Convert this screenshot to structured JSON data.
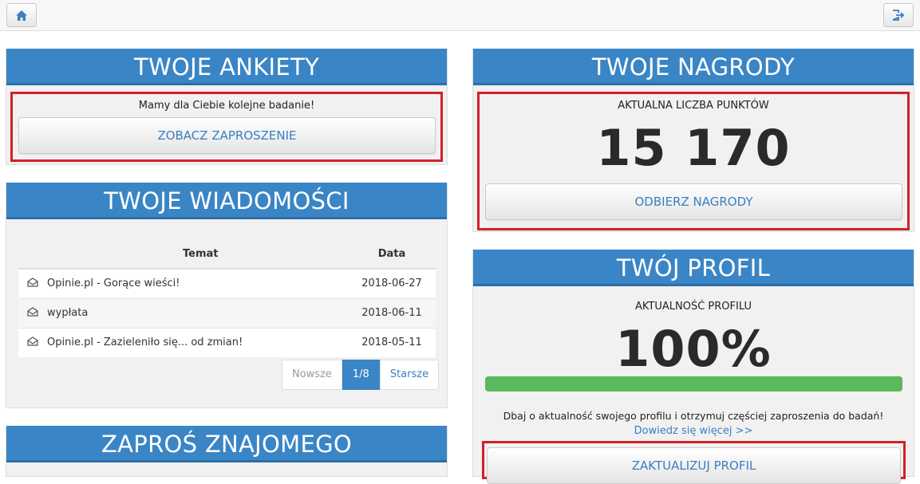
{
  "colors": {
    "header": "#3a85c6",
    "highlight": "#d32027",
    "link": "#3a7fc1",
    "progress": "#5cb85c"
  },
  "topbar": {
    "home_icon": "home-icon",
    "logout_icon": "logout-icon"
  },
  "surveys": {
    "title": "TWOJE ANKIETY",
    "message": "Mamy dla Ciebie kolejne badanie!",
    "button": "ZOBACZ ZAPROSZENIE"
  },
  "messages": {
    "title": "TWOJE WIADOMOŚCI",
    "headers": {
      "subject": "Temat",
      "date": "Data"
    },
    "rows": [
      {
        "subject": "Opinie.pl - Gorące wieści!",
        "date": "2018-06-27"
      },
      {
        "subject": "wypłata",
        "date": "2018-06-11"
      },
      {
        "subject": "Opinie.pl - Zazieleniło się... od zmian!",
        "date": "2018-05-11"
      }
    ],
    "pager": {
      "prev": "Nowsze",
      "current": "1/8",
      "next": "Starsze"
    }
  },
  "invite": {
    "title": "ZAPROŚ ZNAJOMEGO"
  },
  "rewards": {
    "title": "TWOJE NAGRODY",
    "caption": "AKTUALNA LICZBA PUNKTÓW",
    "points": "15 170",
    "button": "ODBIERZ NAGRODY"
  },
  "profile": {
    "title": "TWÓJ PROFIL",
    "caption": "AKTUALNOŚĆ PROFILU",
    "percent_text": "100%",
    "progress_fraction": 1.0,
    "hint": "Dbaj o aktualność swojego profilu i otrzymuj częściej zaproszenia do badań!",
    "learn_more": "Dowiedz się więcej >>",
    "button": "ZAKTUALIZUJ PROFIL"
  }
}
